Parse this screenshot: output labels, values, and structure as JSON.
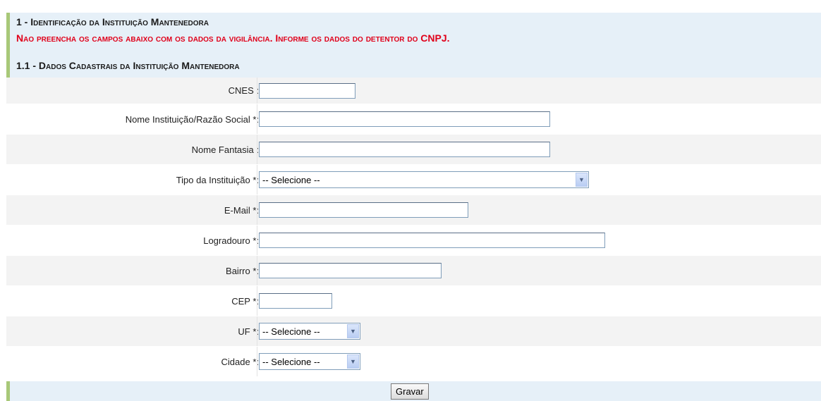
{
  "section": {
    "title": "1 - Identificação da Instituição Mantenedora",
    "warning": "Nao preencha os campos abaixo com os dados da vigilância. Informe os dados do detentor do CNPJ.",
    "subtitle": "1.1 - Dados Cadastrais da Instituição Mantenedora"
  },
  "fields": {
    "cnes": {
      "label": "CNES :",
      "value": ""
    },
    "nome": {
      "label": "Nome Instituição/Razão Social *:",
      "value": ""
    },
    "fantasia": {
      "label": "Nome Fantasia :",
      "value": ""
    },
    "tipo": {
      "label": "Tipo da Instituição *:",
      "selected": "-- Selecione --"
    },
    "email": {
      "label": "E-Mail *:",
      "value": ""
    },
    "logradouro": {
      "label": "Logradouro *:",
      "value": ""
    },
    "bairro": {
      "label": "Bairro *:",
      "value": ""
    },
    "cep": {
      "label": "CEP *:",
      "value": ""
    },
    "uf": {
      "label": "UF *:",
      "selected": "-- Selecione --"
    },
    "cidade": {
      "label": "Cidade *:",
      "selected": "-- Selecione --"
    }
  },
  "actions": {
    "save_label": "Gravar"
  },
  "colors": {
    "warning": "#e0001a",
    "header_bg": "#e6f0f8",
    "accent_bar": "#a8c878"
  },
  "icons": {
    "dropdown": "chevron-down-icon"
  }
}
